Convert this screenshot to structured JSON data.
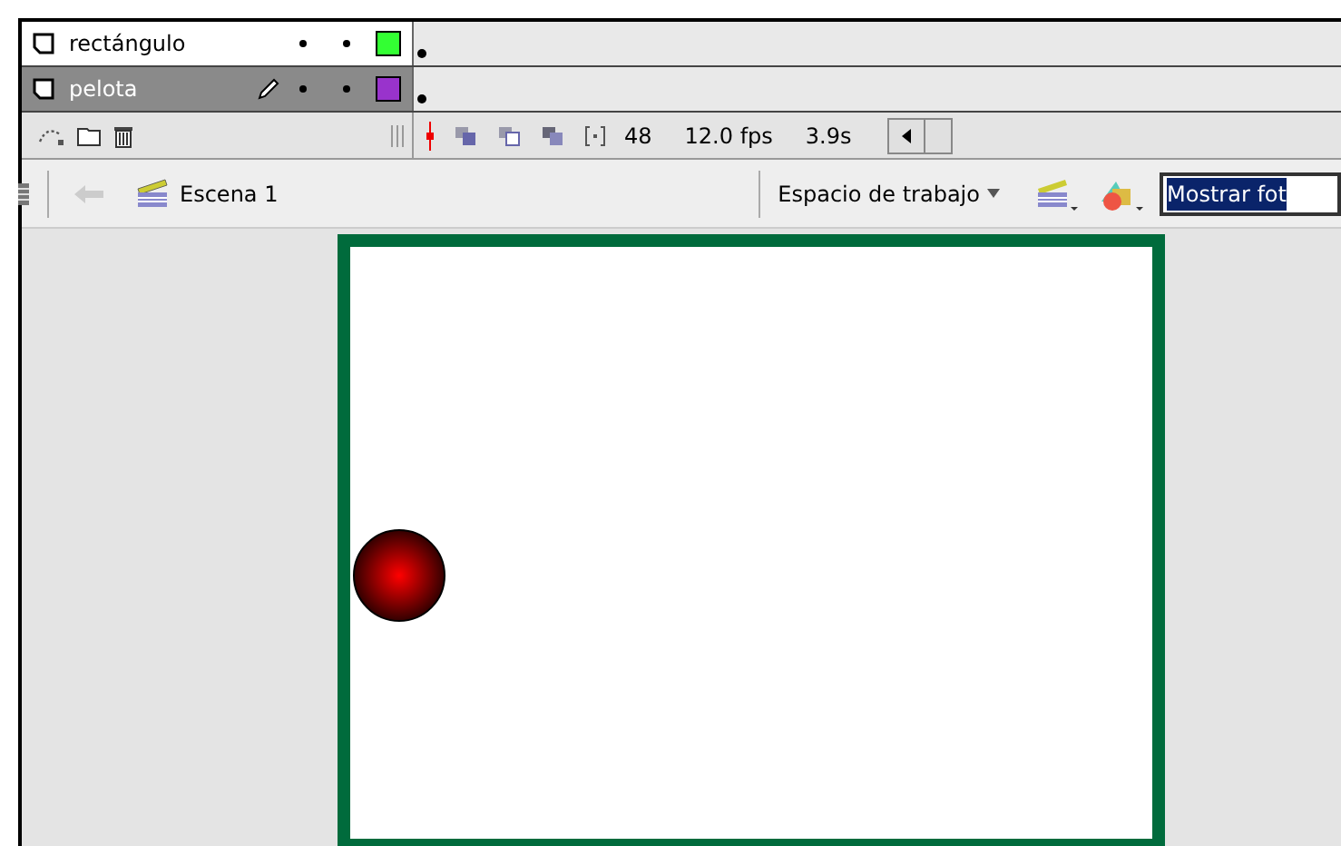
{
  "layers": [
    {
      "name": "rectángulo",
      "selected": false,
      "editing": false,
      "color": "#33ff33"
    },
    {
      "name": "pelota",
      "selected": true,
      "editing": true,
      "color": "#9933cc"
    }
  ],
  "timeline_status": {
    "frame": "48",
    "rate": "12.0 fps",
    "time": "3.9s"
  },
  "scene": {
    "name": "Escena 1"
  },
  "workspace_menu": {
    "label": "Espacio de trabajo"
  },
  "zoom_field": {
    "value": "Mostrar fot",
    "text_selected": true
  }
}
